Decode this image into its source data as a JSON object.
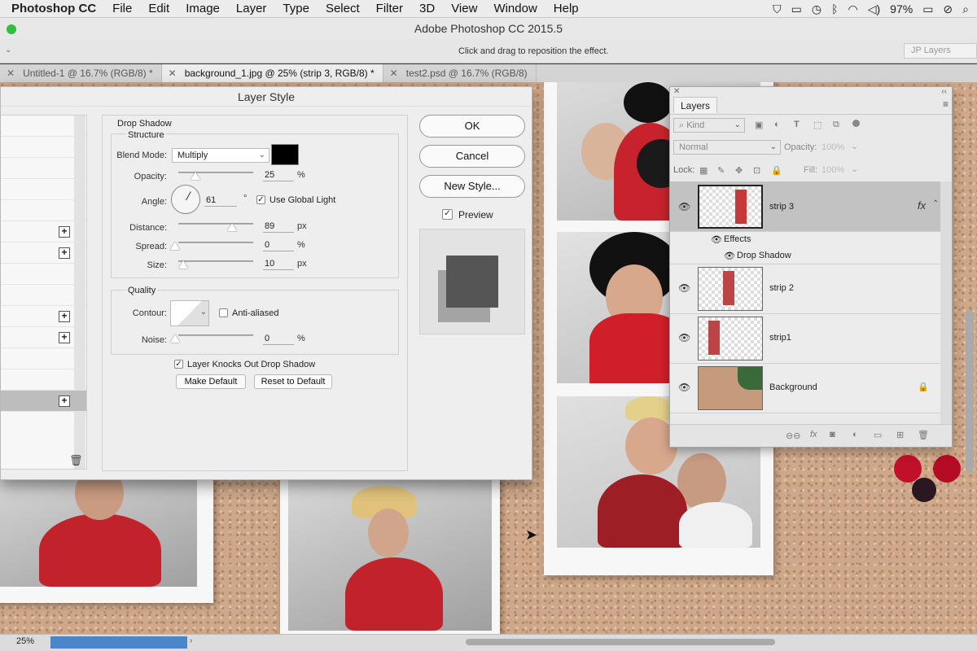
{
  "menubar": {
    "app": "Photoshop CC",
    "items": [
      "File",
      "Edit",
      "Image",
      "Layer",
      "Type",
      "Select",
      "Filter",
      "3D",
      "View",
      "Window",
      "Help"
    ],
    "battery": "97%"
  },
  "window": {
    "title": "Adobe Photoshop CC 2015.5"
  },
  "options": {
    "hint": "Click and drag to reposition the effect.",
    "workspace": "JP Layers"
  },
  "tabs": [
    {
      "label": "Untitled-1 @ 16.7% (RGB/8) *",
      "active": false
    },
    {
      "label": "background_1.jpg @ 25% (strip 3, RGB/8) *",
      "active": true
    },
    {
      "label": "test2.psd @ 16.7% (RGB/8)",
      "active": false
    }
  ],
  "dialog": {
    "title": "Layer Style",
    "section": "Drop Shadow",
    "structure": "Structure",
    "blend_mode_label": "Blend Mode:",
    "blend_mode": "Multiply",
    "shadow_color": "#000000",
    "opacity_label": "Opacity:",
    "opacity": "25",
    "angle_label": "Angle:",
    "angle": "61",
    "angle_unit": "°",
    "use_global_light": "Use Global Light",
    "distance_label": "Distance:",
    "distance": "89",
    "spread_label": "Spread:",
    "spread": "0",
    "size_label": "Size:",
    "size": "10",
    "unit_pct": "%",
    "unit_px": "px",
    "quality": "Quality",
    "contour_label": "Contour:",
    "anti_aliased": "Anti-aliased",
    "noise_label": "Noise:",
    "noise": "0",
    "knockout": "Layer Knocks Out Drop Shadow",
    "make_default": "Make Default",
    "reset_default": "Reset to Default",
    "ok": "OK",
    "cancel": "Cancel",
    "new_style": "New Style...",
    "preview": "Preview"
  },
  "layers_panel": {
    "tab": "Layers",
    "kind": "Kind",
    "blend": "Normal",
    "opacity_label": "Opacity:",
    "opacity": "100%",
    "lock_label": "Lock:",
    "fill_label": "Fill:",
    "fill": "100%",
    "fx": "fx",
    "effects": "Effects",
    "drop_shadow": "Drop Shadow",
    "layers": [
      "strip 3",
      "strip 2",
      "strip1",
      "Background"
    ]
  },
  "status": {
    "zoom": "25%"
  }
}
